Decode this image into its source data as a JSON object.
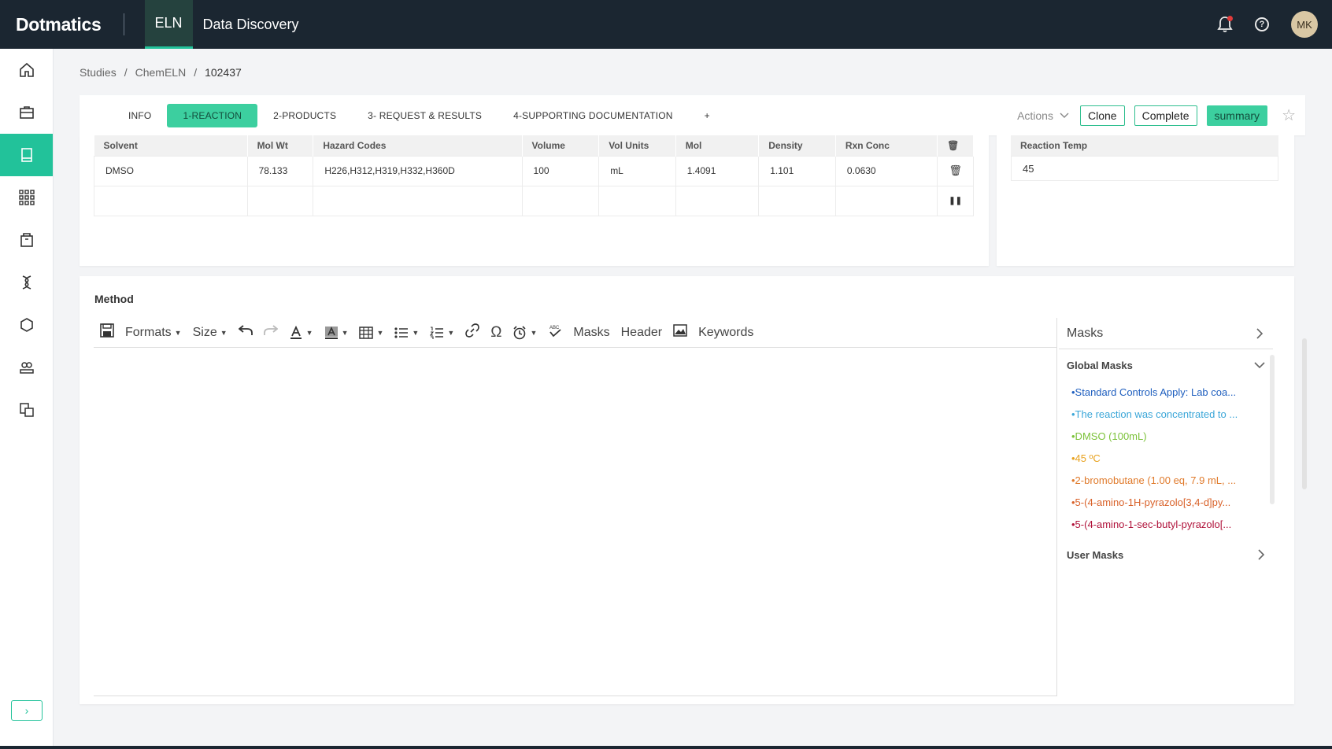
{
  "topbar": {
    "logo": "Dotmatics",
    "tabs": [
      {
        "label": "ELN"
      },
      {
        "label": "Data Discovery"
      }
    ],
    "avatar_initials": "MK"
  },
  "breadcrumb": {
    "items": [
      "Studies",
      "ChemELN",
      "102437"
    ]
  },
  "tabs": {
    "items": [
      "INFO",
      "1-REACTION",
      "2-PRODUCTS",
      "3- REQUEST & RESULTS",
      "4-SUPPORTING DOCUMENTATION",
      "+"
    ],
    "active": "1-REACTION",
    "actions_label": "Actions",
    "clone_label": "Clone",
    "complete_label": "Complete",
    "summary_label": "summary"
  },
  "solvent_table": {
    "headers": [
      "Solvent",
      "Mol Wt",
      "Hazard Codes",
      "Volume",
      "Vol Units",
      "Mol",
      "Density",
      "Rxn Conc"
    ],
    "rows": [
      [
        "DMSO",
        "78.133",
        "H226,H312,H319,H332,H360D",
        "100",
        "mL",
        "1.4091",
        "1.101",
        "0.0630"
      ]
    ]
  },
  "reaction_temp": {
    "header": "Reaction Temp",
    "value": "45"
  },
  "method": {
    "title": "Method",
    "toolbar": {
      "formats": "Formats",
      "size": "Size",
      "masks": "Masks",
      "header": "Header",
      "keywords": "Keywords"
    }
  },
  "masks_panel": {
    "title": "Masks",
    "global_title": "Global Masks",
    "items": [
      {
        "text": "•Standard Controls Apply: Lab coa...",
        "color": "#1f5fbf"
      },
      {
        "text": "•The reaction was concentrated to ...",
        "color": "#3aa6d8"
      },
      {
        "text": "•DMSO (100mL)",
        "color": "#7cc23a"
      },
      {
        "text": "•45 ºC",
        "color": "#e8a21e"
      },
      {
        "text": "•2-bromobutane (1.00 eq, 7.9 mL, ...",
        "color": "#e07a2b"
      },
      {
        "text": "•5-(4-amino-1H-pyrazolo[3,4-d]py...",
        "color": "#d9622a"
      },
      {
        "text": "•5-(4-amino-1-sec-butyl-pyrazolo[...",
        "color": "#b0123a"
      }
    ],
    "user_title": "User Masks"
  },
  "colors": {
    "accent": "#3ccf9f",
    "topbar": "#1b2631"
  }
}
